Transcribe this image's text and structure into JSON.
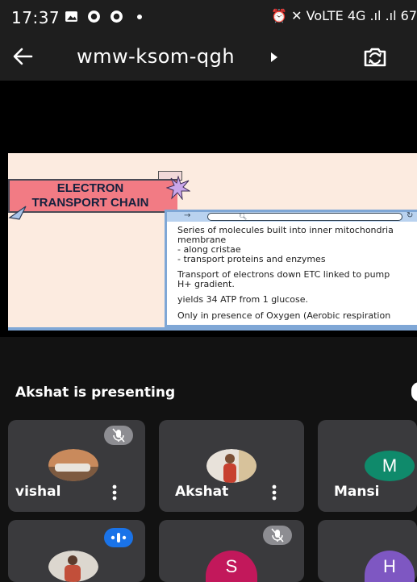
{
  "status_bar": {
    "time": "17:37",
    "right_indicators": "⏰ ✕ VoLTE 4G .ıl .ıl 67"
  },
  "app_bar": {
    "meeting_code": "wmw-ksom-qgh"
  },
  "slide": {
    "title_line1": "ELECTRON",
    "title_line2": "TRANSPORT CHAIN",
    "lines": [
      "Series of molecules built into inner mitochondria",
      "membrane",
      "- along cristae",
      "- transport proteins and enzymes",
      "Transport of electrons down ETC linked to pump",
      "H+ gradient.",
      "yields 34 ATP from 1 glucose.",
      "Only in presence of Oxygen (Aerobic respiration"
    ]
  },
  "presenting": {
    "label": "Akshat is presenting"
  },
  "participants": [
    {
      "name": "vishal",
      "avatar": "photo",
      "mic_muted": true
    },
    {
      "name": "Akshat",
      "avatar": "photo",
      "mic_muted": false
    },
    {
      "name": "Mansi",
      "avatar_letter": "M",
      "avatar_color": "#0f8a6b"
    },
    {
      "name": "",
      "avatar": "photo",
      "speaking": true
    },
    {
      "name": "",
      "avatar_letter": "S",
      "avatar_color": "#c2185b",
      "mic_muted": true
    },
    {
      "name": "",
      "avatar_letter": "H",
      "avatar_color": "#7e57c2"
    }
  ],
  "colors": {
    "background": "#121212",
    "tile": "#3a3a3d",
    "slide_background": "#fcebe0",
    "slide_title_box": "#f27b84",
    "speaking_badge": "#1a73e8",
    "muted_badge": "#8d8d92"
  }
}
